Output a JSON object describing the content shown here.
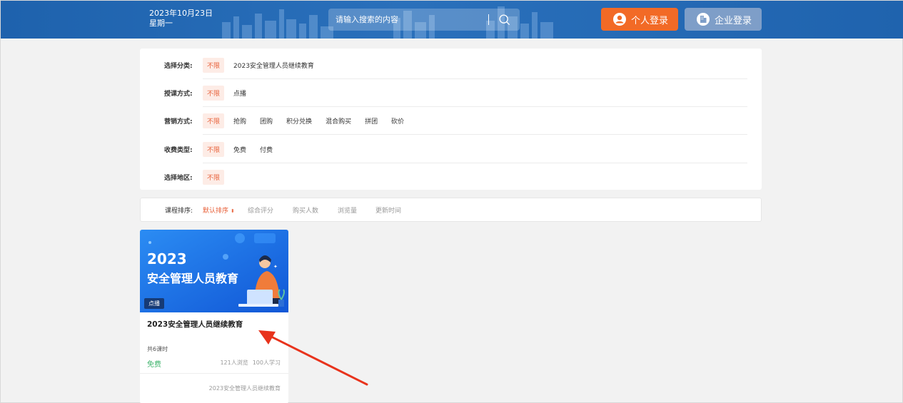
{
  "header": {
    "date": "2023年10月23日",
    "weekday": "星期一",
    "search_placeholder": "请输入搜索的内容",
    "personal_login": "个人登录",
    "enterprise_login": "企业登录",
    "bg_color": "#1e62ad",
    "personal_color": "#f26a26",
    "enterprise_color": "#7e9ec8"
  },
  "filters": {
    "category": {
      "label": "选择分类:",
      "options": [
        "不限",
        "2023安全管理人员继续教育"
      ]
    },
    "teaching": {
      "label": "授课方式:",
      "options": [
        "不限",
        "点播"
      ]
    },
    "marketing": {
      "label": "营销方式:",
      "options": [
        "不限",
        "抢购",
        "团购",
        "积分兑换",
        "混合购买",
        "拼团",
        "砍价"
      ]
    },
    "fee": {
      "label": "收费类型:",
      "options": [
        "不限",
        "免费",
        "付费"
      ]
    },
    "region": {
      "label": "选择地区:",
      "options": [
        "不限"
      ]
    }
  },
  "sort": {
    "label": "课程排序:",
    "items": [
      "默认排序",
      "综合评分",
      "购买人数",
      "浏览量",
      "更新时间"
    ],
    "active_arrow": "⬍"
  },
  "course_card": {
    "banner_year": "2023",
    "banner_title": "安全管理人员教育",
    "badge": "点播",
    "title": "2023安全管理人员继续教育",
    "hours": "共6课时",
    "price": "免费",
    "views": "121人浏览",
    "learners": "100人学习",
    "category": "2023安全管理人员继续教育"
  },
  "icons": {
    "search": "search-icon",
    "personal": "user-icon",
    "enterprise": "building-icon",
    "sort": "sort-arrows-icon"
  },
  "accent_color": "#e8623b"
}
